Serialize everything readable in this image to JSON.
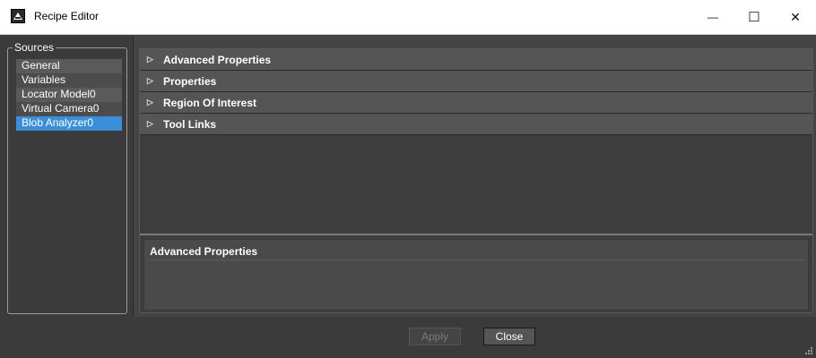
{
  "window": {
    "title": "Recipe Editor"
  },
  "window_controls": {
    "minimize": "—",
    "maximize": "☐",
    "close": "✕"
  },
  "sources": {
    "legend": "Sources",
    "items": [
      {
        "label": "General"
      },
      {
        "label": "Variables"
      },
      {
        "label": "Locator Model0"
      },
      {
        "label": "Virtual Camera0"
      },
      {
        "label": "Blob Analyzer0"
      }
    ],
    "selected": "Blob Analyzer0"
  },
  "sections": [
    {
      "label": "Advanced Properties"
    },
    {
      "label": "Properties"
    },
    {
      "label": "Region Of Interest"
    },
    {
      "label": "Tool Links"
    }
  ],
  "description": {
    "title": "Advanced Properties"
  },
  "footer": {
    "apply_label": "Apply",
    "close_label": "Close"
  },
  "colors": {
    "selection": "#3a8fd8",
    "background": "#3b3b3b",
    "section_header": "#555555"
  }
}
